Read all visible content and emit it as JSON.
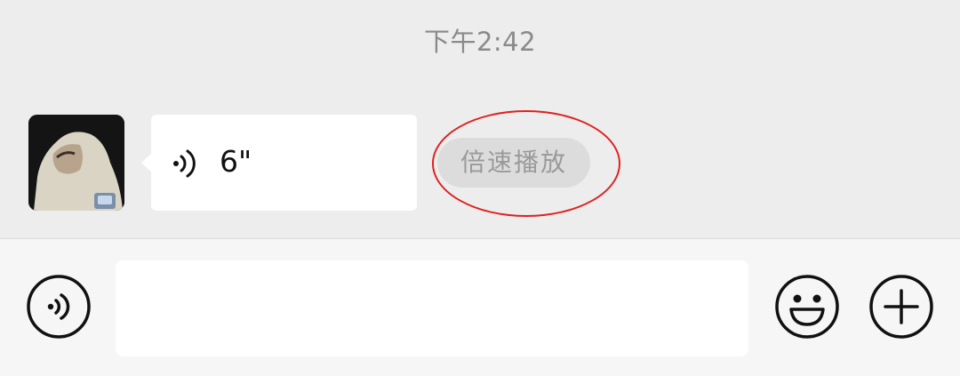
{
  "chat": {
    "timestamp": "下午2:42",
    "message": {
      "type": "voice",
      "duration": "6\"",
      "icon": "voice-wave-icon"
    },
    "speed_button_label": "倍速播放",
    "avatar": "user-avatar-photo"
  },
  "input_bar": {
    "voice_toggle_icon": "voice-mode-icon",
    "text_value": "",
    "emoji_icon": "emoji-icon",
    "more_icon": "plus-icon"
  },
  "colors": {
    "chat_background": "#ededed",
    "bubble": "#ffffff",
    "annotation_circle": "#e02020",
    "input_bar_background": "#f6f6f6"
  }
}
